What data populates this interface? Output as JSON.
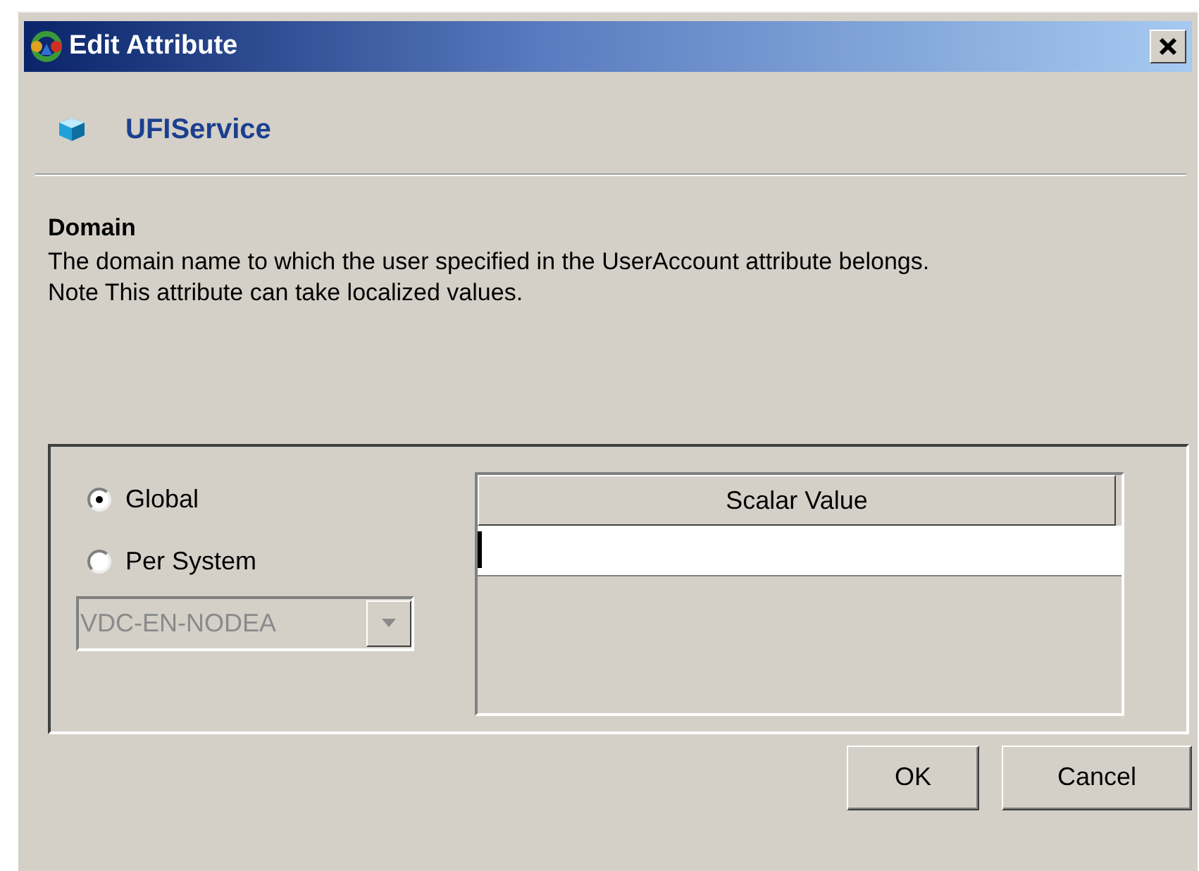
{
  "window": {
    "title": "Edit Attribute"
  },
  "object": {
    "name": "UFIService"
  },
  "attribute": {
    "name": "Domain",
    "description": [
      "The domain name to which the user specified in the UserAccount attribute belongs.",
      "Note This attribute can take localized values."
    ]
  },
  "scope": [
    {
      "label": "Global",
      "selected": true
    },
    {
      "label": "Per System",
      "selected": false
    }
  ],
  "system_select": {
    "value": "VDC-EN-NODEA",
    "disabled": true
  },
  "table": {
    "columns": [
      "Scalar Value"
    ]
  },
  "buttons": [
    "OK",
    "Cancel"
  ]
}
